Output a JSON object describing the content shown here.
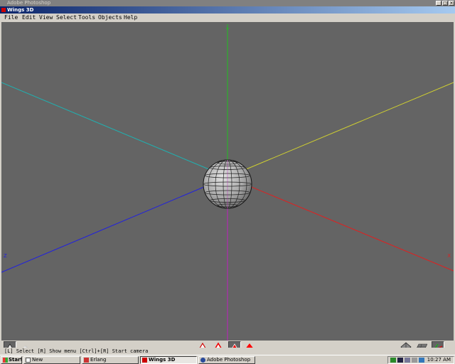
{
  "photoshop": {
    "title": "Adobe Photoshop"
  },
  "window": {
    "title": "Wings 3D"
  },
  "menu": [
    "File",
    "Edit",
    "View",
    "Select",
    "Tools",
    "Objects",
    "Help"
  ],
  "axes": {
    "y": "Y",
    "z": "Z",
    "x": "X"
  },
  "colors": {
    "viewport_bg": "#646464",
    "x_axis": "#e02020",
    "y_axis": "#20c020",
    "z_axis": "#2020e0",
    "neg_x": "#d0d030",
    "neg_y": "#c020c0",
    "neg_z": "#20b0b0"
  },
  "toolbar": {
    "left_icons": [
      "wireframe-shaded-icon",
      "smooth-preview-icon"
    ],
    "center_icons": [
      "vertex-select-icon",
      "edge-select-icon",
      "face-select-icon",
      "body-select-icon"
    ],
    "right_icons": [
      "perspective-icon",
      "ground-plane-icon",
      "axes-icon"
    ]
  },
  "status": "[L] Select  [R] Show menu  [Ctrl]+[R] Start camera",
  "taskbar": {
    "start": "Start",
    "tasks": [
      "New",
      "Erlang",
      "Wings 3D",
      "Adobe Photoshop"
    ],
    "active_task": "Wings 3D",
    "clock": "10:27 AM"
  }
}
